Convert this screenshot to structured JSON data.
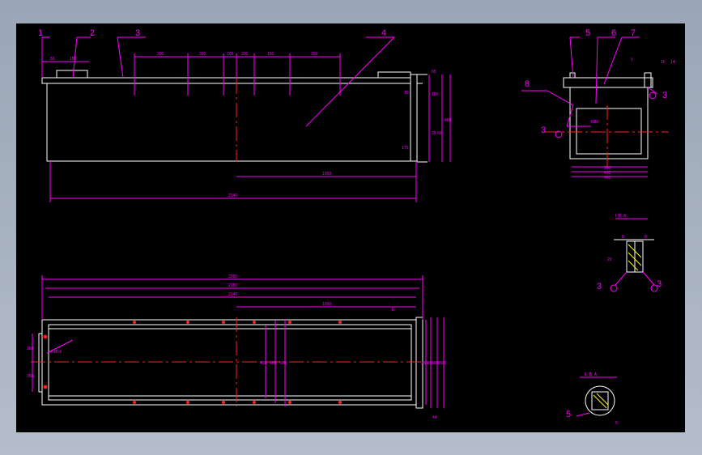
{
  "colors": {
    "background": "#000000",
    "outline": "#ffffff",
    "dimension": "#ff00ff",
    "centerline": "#ff2020",
    "frame": "#a9b3c1"
  },
  "front_view": {
    "balloons": [
      "1",
      "2",
      "3",
      "4"
    ],
    "dims_top": [
      "50",
      "180",
      "300",
      "300",
      "200",
      "200",
      "150",
      "300"
    ],
    "dims_right": [
      "10",
      "180",
      "25",
      "60",
      "460",
      "170"
    ],
    "dim_right_top": "65",
    "dim_bottom_partial": "1000",
    "dim_total": "2140"
  },
  "side_view": {
    "balloons": [
      "5",
      "6",
      "7",
      "8"
    ],
    "weld_symbols": [
      "3",
      "3",
      "3"
    ],
    "detail_marker": "I",
    "dim_top_right": "10",
    "dim_top_right2": "14",
    "dim_diag": "R80",
    "dims_bottom": [
      "380",
      "400",
      "460"
    ]
  },
  "plan_view": {
    "dims_top": [
      "2250",
      "2180",
      "2140",
      "1050"
    ],
    "dims_left": [
      "160",
      "350"
    ],
    "dims_center": [
      "400",
      "460",
      "500"
    ],
    "dims_right": [
      "380",
      "400",
      "460",
      "500"
    ],
    "dim_bottom_right": "44",
    "hole_note": "4-Ø14",
    "marker": "E"
  },
  "detail_I": {
    "title": "I 放 大",
    "dims": [
      "8",
      "8",
      "20"
    ],
    "weld_symbols": [
      "3",
      "3"
    ]
  },
  "detail_E": {
    "title": "E 放 大",
    "balloon": "5",
    "dim": "5"
  }
}
